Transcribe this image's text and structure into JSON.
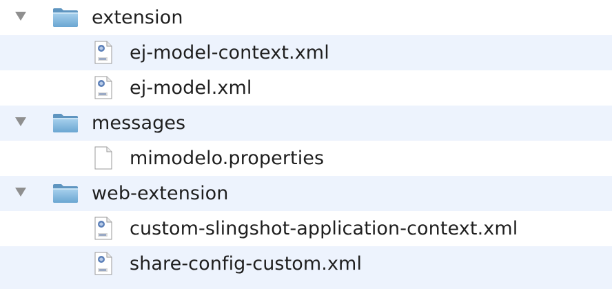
{
  "file_tree": {
    "rows": [
      {
        "kind": "folder",
        "label": "extension",
        "expanded": true,
        "icon": "folder-icon"
      },
      {
        "kind": "file",
        "label": "ej-model-context.xml",
        "icon": "xml-file-icon"
      },
      {
        "kind": "file",
        "label": "ej-model.xml",
        "icon": "xml-file-icon"
      },
      {
        "kind": "folder",
        "label": "messages",
        "expanded": true,
        "icon": "folder-icon"
      },
      {
        "kind": "file",
        "label": "mimodelo.properties",
        "icon": "document-icon"
      },
      {
        "kind": "folder",
        "label": "web-extension",
        "expanded": true,
        "icon": "folder-icon"
      },
      {
        "kind": "file",
        "label": "custom-slingshot-application-context.xml",
        "icon": "xml-file-icon"
      },
      {
        "kind": "file",
        "label": "share-config-custom.xml",
        "icon": "xml-file-icon"
      }
    ]
  },
  "colors": {
    "alternate_row": "#edf3fd",
    "folder_blue": "#7fb6de",
    "disclosure_grey": "#8f8f8f",
    "text": "#1f1f1f"
  }
}
